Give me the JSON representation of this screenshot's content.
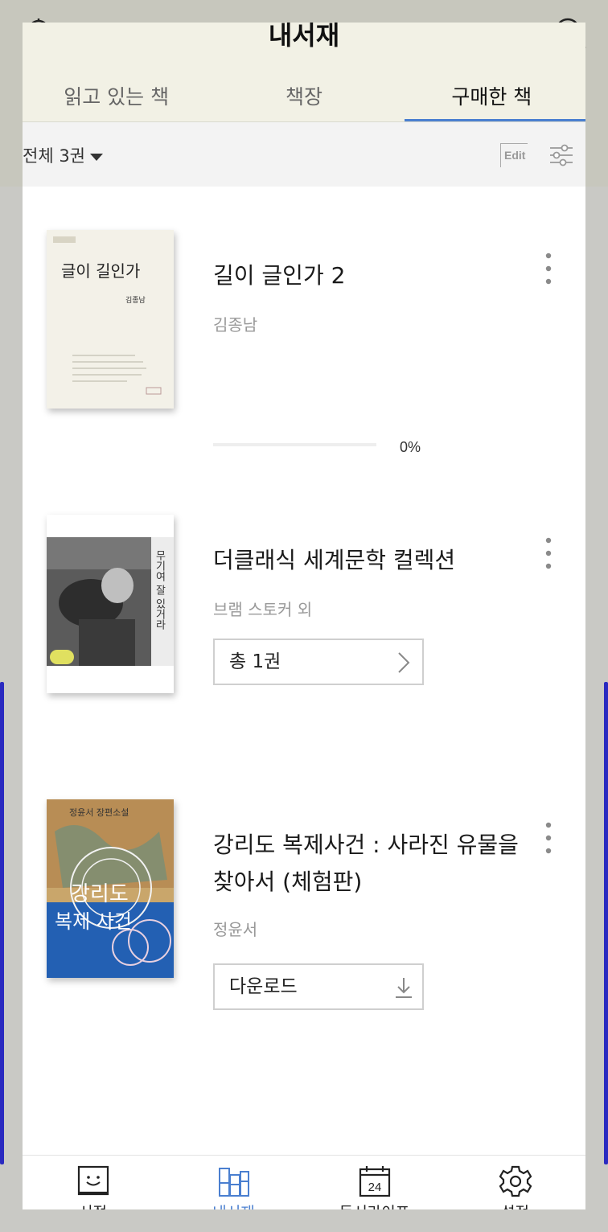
{
  "header": {
    "title": "내서재"
  },
  "tabs": [
    {
      "label": "읽고 있는 책"
    },
    {
      "label": "책장"
    },
    {
      "label": "구매한 책",
      "active": true
    }
  ],
  "filter": {
    "label": "전체 3권",
    "edit_label": "Edit"
  },
  "books": [
    {
      "title": "길이 글인가 2",
      "author": "김종남",
      "progress_text": "0%",
      "progress": 0,
      "cover_title": "글이 길인가",
      "cover_author": "김종남"
    },
    {
      "title": "더클래식 세계문학 컬렉션",
      "author": "브램 스토커 외",
      "action_label": "총 1권",
      "cover_title": "무기여 잘 있거라"
    },
    {
      "title": "강리도 복제사건 : 사라진 유물을 찾아서 (체험판)",
      "author": "정윤서",
      "action_label": "다운로드",
      "cover_top": "정윤서 장편소설",
      "cover_title_line1": "강리도",
      "cover_title_line2": "복제 사건"
    }
  ],
  "bottom_nav": [
    {
      "label": "서점",
      "icon": "store-icon"
    },
    {
      "label": "내서재",
      "icon": "library-icon",
      "active": true
    },
    {
      "label": "독서라이프",
      "icon": "calendar-icon",
      "day": "24"
    },
    {
      "label": "설정",
      "icon": "gear-icon"
    }
  ],
  "colors": {
    "accent": "#4a7fd0",
    "topbar": "#f2f1e5",
    "sidebar_accent": "#2a2ac0"
  }
}
